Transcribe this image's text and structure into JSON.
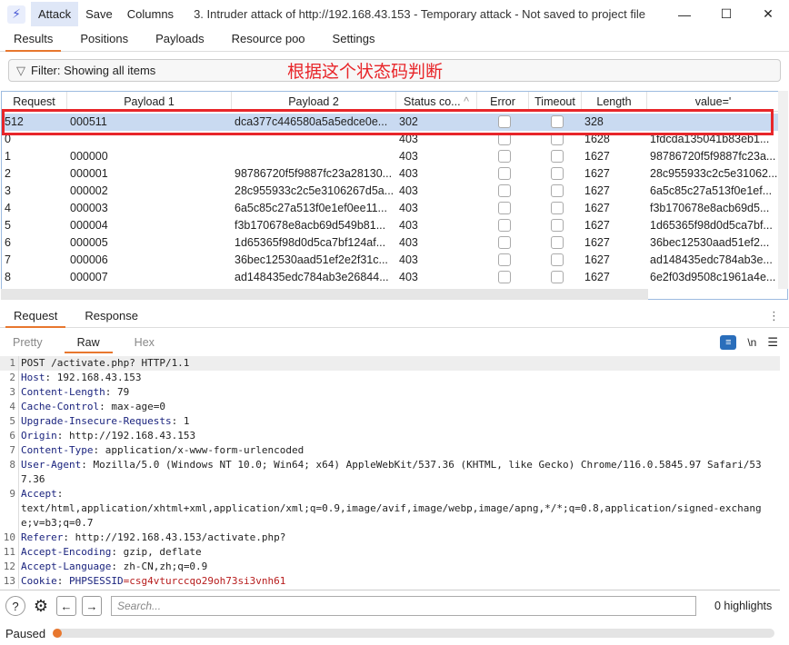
{
  "titlebar": {
    "menu": [
      "Attack",
      "Save",
      "Columns"
    ],
    "title": "3. Intruder attack of http://192.168.43.153 - Temporary attack - Not saved to project file"
  },
  "tabs": [
    "Results",
    "Positions",
    "Payloads",
    "Resource poo",
    "Settings"
  ],
  "filter": {
    "label": "Filter: Showing all items"
  },
  "annotation": "根据这个状态码判断",
  "table": {
    "columns": [
      "Request",
      "Payload 1",
      "Payload 2",
      "Status co...",
      "Error",
      "Timeout",
      "Length",
      "value='"
    ],
    "sort_icon": "chevron-up-icon",
    "rows": [
      {
        "req": "512",
        "p1": "000511",
        "p2": "dca377c446580a5a5edce0e...",
        "status": "302",
        "len": "328",
        "value": ""
      },
      {
        "req": "0",
        "p1": "",
        "p2": "",
        "status": "403",
        "len": "1628",
        "value": "1fdcda135041b83eb1..."
      },
      {
        "req": "1",
        "p1": "000000",
        "p2": "",
        "status": "403",
        "len": "1627",
        "value": "98786720f5f9887fc23a..."
      },
      {
        "req": "2",
        "p1": "000001",
        "p2": "98786720f5f9887fc23a28130...",
        "status": "403",
        "len": "1627",
        "value": "28c955933c2c5e31062..."
      },
      {
        "req": "3",
        "p1": "000002",
        "p2": "28c955933c2c5e3106267d5a...",
        "status": "403",
        "len": "1627",
        "value": "6a5c85c27a513f0e1ef..."
      },
      {
        "req": "4",
        "p1": "000003",
        "p2": "6a5c85c27a513f0e1ef0ee11...",
        "status": "403",
        "len": "1627",
        "value": "f3b170678e8acb69d5..."
      },
      {
        "req": "5",
        "p1": "000004",
        "p2": "f3b170678e8acb69d549b81...",
        "status": "403",
        "len": "1627",
        "value": "1d65365f98d0d5ca7bf..."
      },
      {
        "req": "6",
        "p1": "000005",
        "p2": "1d65365f98d0d5ca7bf124af...",
        "status": "403",
        "len": "1627",
        "value": "36bec12530aad51ef2..."
      },
      {
        "req": "7",
        "p1": "000006",
        "p2": "36bec12530aad51ef2e2f31c...",
        "status": "403",
        "len": "1627",
        "value": "ad148435edc784ab3e..."
      },
      {
        "req": "8",
        "p1": "000007",
        "p2": "ad148435edc784ab3e26844...",
        "status": "403",
        "len": "1627",
        "value": "6e2f03d9508c1961a4e..."
      }
    ]
  },
  "reqres_tabs": [
    "Request",
    "Response"
  ],
  "view_tabs": [
    "Pretty",
    "Raw",
    "Hex"
  ],
  "view_icons": [
    "wrap-icon",
    "newline-icon",
    "menu-icon"
  ],
  "newline_label": "\\n",
  "request_lines": [
    {
      "n": "1",
      "k": "",
      "v": "POST /activate.php? HTTP/1.1"
    },
    {
      "n": "2",
      "k": "Host",
      "v": ": 192.168.43.153"
    },
    {
      "n": "3",
      "k": "Content-Length",
      "v": ": 79"
    },
    {
      "n": "4",
      "k": "Cache-Control",
      "v": ": max-age=0"
    },
    {
      "n": "5",
      "k": "Upgrade-Insecure-Requests",
      "v": ": 1"
    },
    {
      "n": "6",
      "k": "Origin",
      "v": ": http://192.168.43.153"
    },
    {
      "n": "7",
      "k": "Content-Type",
      "v": ": application/x-www-form-urlencoded"
    },
    {
      "n": "8",
      "k": "User-Agent",
      "v": ": Mozilla/5.0 (Windows NT 10.0; Win64; x64) AppleWebKit/537.36 (KHTML, like Gecko) Chrome/116.0.5845.97 Safari/537.36"
    },
    {
      "n": "9",
      "k": "Accept",
      "v": ":\ntext/html,application/xhtml+xml,application/xml;q=0.9,image/avif,image/webp,image/apng,*/*;q=0.8,application/signed-exchange;v=b3;q=0.7"
    },
    {
      "n": "10",
      "k": "Referer",
      "v": ": http://192.168.43.153/activate.php?"
    },
    {
      "n": "11",
      "k": "Accept-Encoding",
      "v": ": gzip, deflate"
    },
    {
      "n": "12",
      "k": "Accept-Language",
      "v": ": zh-CN,zh;q=0.9"
    },
    {
      "n": "13",
      "k": "Cookie",
      "v": ": ",
      "ck": "PHPSESSID",
      "cv": "=csg4vturccqo29oh73si3vnh61"
    }
  ],
  "search": {
    "placeholder": "Search..."
  },
  "highlights": "0 highlights",
  "status": {
    "label": "Paused",
    "progress_percent": 1
  },
  "colors": {
    "accent": "#e8772e",
    "selection": "#c9daf1",
    "annotation": "#e8262a"
  }
}
